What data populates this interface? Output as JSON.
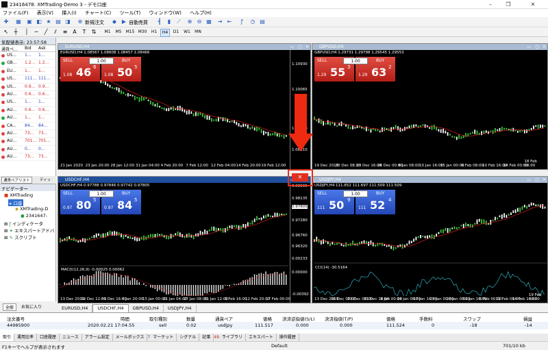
{
  "window": {
    "title": "23416478: XMTrading-Demo 3 - デモ口座"
  },
  "menu": [
    "ファイル(F)",
    "表示(V)",
    "挿入(I)",
    "チャート(C)",
    "ツール(T)",
    "ウィンドウ(W)",
    "ヘルプ(H)"
  ],
  "toolbar": {
    "new_order": "新規注文",
    "auto_trade": "自動売買",
    "timeframes": [
      "M1",
      "M5",
      "M15",
      "M30",
      "H1",
      "H4",
      "D1",
      "W1",
      "MN"
    ],
    "active_tf": "H4"
  },
  "market_watch": {
    "header": "気配値表示: 23:57:58",
    "cols": [
      "通貨ペ...",
      "Bid",
      "Ask"
    ],
    "rows": [
      [
        "US...",
        "1...",
        "1..."
      ],
      [
        "GB...",
        "1.2...",
        "1.2..."
      ],
      [
        "EU...",
        "1...",
        "1..."
      ],
      [
        "US...",
        "111...",
        "111..."
      ],
      [
        "US...",
        "0.9...",
        "0.9..."
      ],
      [
        "AU...",
        "0.6...",
        "0.6..."
      ],
      [
        "US...",
        "1...",
        "1..."
      ],
      [
        "AU...",
        "0.6...",
        "0.6..."
      ],
      [
        "AU...",
        "1...",
        "1..."
      ],
      [
        "CA...",
        "84...",
        "84..."
      ],
      [
        "AU...",
        "73...",
        "73..."
      ],
      [
        "AU...",
        "701...",
        "701..."
      ],
      [
        "AU...",
        "0...",
        "0..."
      ],
      [
        "AU...",
        "73...",
        "73..."
      ]
    ],
    "tabs": [
      "通貨ペアリスト",
      "ティッ"
    ]
  },
  "navigator": {
    "header": "ナビゲーター",
    "items": [
      "XMTrading",
      "口座",
      "XMTrading-D",
      "2341647-",
      "インディケータ",
      "エキスパートアドバ",
      "スクリプト"
    ],
    "tabs": [
      "全般",
      "お気に入り"
    ]
  },
  "charts": [
    {
      "title": "EURUSD,H4",
      "info": "EURUSD,H4 1.08567 1.08608 1.08457 1.08466",
      "sell_big": "46",
      "sell_sup": "6",
      "sell_pre": "1.08",
      "buy_big": "50",
      "buy_sup": "5",
      "buy_pre": "1.08",
      "lot": "1.00",
      "prices": [
        "1.10930",
        "1.10065",
        "1.09130",
        "1.08310"
      ],
      "times": [
        "21 Jan 2020",
        "23 Jan 20:00",
        "28 Jan 12:00",
        "31 Jan 04:00",
        "4 Feb 20:00",
        "7 Feb 12:00",
        "12 Feb 04:00",
        "14 Feb 20:00",
        "19 Feb 12:00"
      ]
    },
    {
      "title": "GBPUSD,H4",
      "info": "GBPUSD,H4 1.29731 1.29798 1.29545 1.29553",
      "sell_big": "55",
      "sell_sup": "3",
      "sell_pre": "1.29",
      "buy_big": "63",
      "buy_sup": "2",
      "buy_pre": "1.29",
      "lot": "1.00",
      "prices": [],
      "times": [
        "19 Dec 2019",
        "20 Dec 08:00",
        "23 Dec 16:00",
        "26 Dec 00:00",
        "8 Jan 08:00",
        "10 Jan 16:00",
        "15 Jan 00:00",
        "6 Feb 08:00",
        "10 Feb 16:00",
        "14 Feb 00:00",
        "18 Feb 08:00"
      ]
    },
    {
      "title": "USDCHF,H4",
      "info": "USDCHF,H4 0.97788 0.97846 0.97742 0.97805",
      "sell_big": "80",
      "sell_sup": "5",
      "sell_pre": "0.97",
      "buy_big": "84",
      "buy_sup": "5",
      "buy_pre": "0.97",
      "lot": "1.00",
      "prices": [
        "0.98595",
        "0.98135",
        "0.97805",
        "0.97280",
        "0.96760",
        "0.96320"
      ],
      "macd": "MACD(12,26,9) -0.00025 0.00062",
      "macd_prices": [
        "0.00233",
        "0.00000",
        "-0.00392"
      ],
      "times": [
        "13 Dec 2019",
        "19 Dec 12:00",
        "31 Dec 16:00",
        "8 Jan 20:00",
        "15 Jan 00:00",
        "21 Jan 04:00",
        "27 Jan 08:00",
        "31 Jan 12:00",
        "6 Feb 16:00",
        "12 Feb 20:00",
        "17 Feb 00:00"
      ]
    },
    {
      "title": "USDJPY,H4",
      "info": "USDJPY,H4 111.652 111.697 111.509 111.509",
      "sell_big": "50",
      "sell_sup": "9",
      "sell_pre": "111",
      "buy_big": "52",
      "buy_sup": "4",
      "buy_pre": "111",
      "lot": "1.00",
      "cci": "CCI(14) -30.5164",
      "times": [
        "13 Dec 2019",
        "18 Dec 00:00",
        "23 Dec 08:00",
        "31 Dec 16:00",
        "9 Jan 00:00",
        "14 Jan 08:00",
        "17 Jan 16:00",
        "23 Jan 00:00",
        "28 Jan 08:00",
        "31 Jan 16:00",
        "6 Feb 00:00",
        "11 Feb 08:00",
        "14 Feb 16:00",
        "19 Feb 00:00"
      ]
    }
  ],
  "chart_tabs": [
    "EURUSD,H4",
    "USDCHF,H4",
    "GBPUSD,H4",
    "USDJPY,H4"
  ],
  "active_chart_tab": "USDCHF,H4",
  "highlight_price": "0.98595",
  "terminal": {
    "headers": [
      "注文番号",
      "時間",
      "取引種別",
      "数量",
      "通貨ペア",
      "価格",
      "決済逆指値(S/L)",
      "決済指値(T/P)",
      "価格",
      "手数料",
      "スワップ",
      "損益"
    ],
    "row": [
      "44985900",
      "2020.02.21 17:04:55",
      "sell",
      "0.02",
      "usdjpy",
      "111.517",
      "0.000",
      "0.000",
      "111.524",
      "0",
      "-18",
      "-14"
    ],
    "tabs": [
      "取引",
      "運用比率",
      "口座履歴",
      "ニュース",
      "アラーム設定",
      "メールボックス",
      "マーケット",
      "シグナル",
      "記事",
      "ライブラリ",
      "エキスパート",
      "操作履歴"
    ],
    "mail_count": "7",
    "articles_count": "49"
  },
  "status": {
    "help": "F1キーでヘルプが表示されます",
    "profile": "Default",
    "traffic": "701/10 kb"
  },
  "sell_label": "SELL",
  "buy_label": "BUY"
}
